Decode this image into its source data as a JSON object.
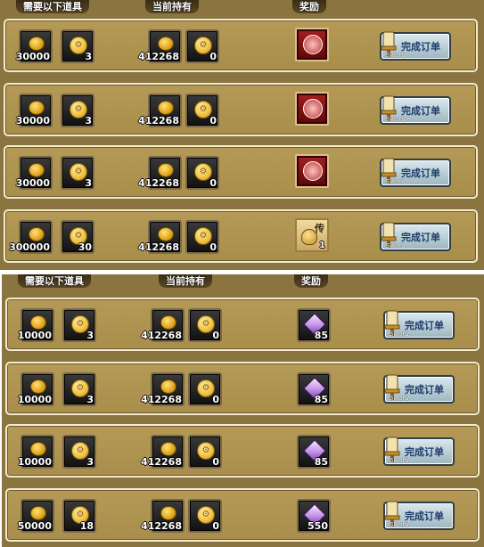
{
  "headers": {
    "top": {
      "required": "需要以下道具",
      "held": "当前持有",
      "reward": "奖励"
    },
    "bottom": {
      "required": "需要以下道具",
      "held": "当前持有",
      "reward": "奖励"
    }
  },
  "button": {
    "label": "完成订单",
    "sub": "Sword"
  },
  "top_rows": [
    {
      "req_coin": "30000",
      "req_token": "3",
      "held_coin": "412268",
      "held_token": "0",
      "reward_type": "red"
    },
    {
      "req_coin": "30000",
      "req_token": "3",
      "held_coin": "412268",
      "held_token": "0",
      "reward_type": "red"
    },
    {
      "req_coin": "30000",
      "req_token": "3",
      "held_coin": "412268",
      "held_token": "0",
      "reward_type": "red"
    },
    {
      "req_coin": "300000",
      "req_token": "30",
      "held_coin": "412268",
      "held_token": "0",
      "reward_type": "scroll",
      "reward_char": "传",
      "reward_count": "1"
    }
  ],
  "bottom_rows": [
    {
      "req_coin": "10000",
      "req_token": "3",
      "held_coin": "412268",
      "held_token": "0",
      "reward_count": "85"
    },
    {
      "req_coin": "10000",
      "req_token": "3",
      "held_coin": "412268",
      "held_token": "0",
      "reward_count": "85"
    },
    {
      "req_coin": "10000",
      "req_token": "3",
      "held_coin": "412268",
      "held_token": "0",
      "reward_count": "85"
    },
    {
      "req_coin": "50000",
      "req_token": "18",
      "held_coin": "412268",
      "held_token": "0",
      "reward_count": "550"
    }
  ]
}
